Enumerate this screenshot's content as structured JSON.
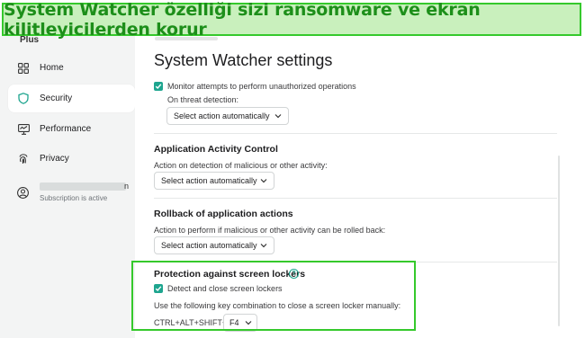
{
  "banner": {
    "text": "System Watcher özelliği sizi ransomware ve ekran kilitleyicilerden korur"
  },
  "sidebar": {
    "brand": "Plus",
    "items": [
      {
        "label": "Home",
        "icon": "grid-icon",
        "active": false
      },
      {
        "label": "Security",
        "icon": "shield-icon",
        "active": true
      },
      {
        "label": "Performance",
        "icon": "monitor-icon",
        "active": false
      },
      {
        "label": "Privacy",
        "icon": "fingerprint-icon",
        "active": false
      }
    ],
    "user": {
      "name_tail": "n",
      "subscription": "Subscription is active",
      "icon": "user-icon"
    }
  },
  "main": {
    "title": "System Watcher settings",
    "monitor": {
      "checkbox_label": "Monitor attempts to perform unauthorized operations",
      "checked": true,
      "sub_label": "On threat detection:",
      "select_value": "Select action automatically"
    },
    "aac": {
      "heading": "Application Activity Control",
      "sub_label": "Action on detection of malicious or other activity:",
      "select_value": "Select action automatically"
    },
    "rollback": {
      "heading": "Rollback of application actions",
      "sub_label": "Action to perform if malicious or other activity can be rolled back:",
      "select_value": "Select action automatically"
    },
    "lockers": {
      "heading": "Protection against screen lockers",
      "help_icon": "?",
      "checkbox_label": "Detect and close screen lockers",
      "checked": true,
      "sub_label": "Use the following key combination to close a screen locker manually:",
      "key_combo": "CTRL+ALT+SHIFT+",
      "key_value": "F4"
    }
  },
  "colors": {
    "accent": "#1ea58f",
    "highlight": "#35c92c",
    "banner_bg": "#c9f0bd",
    "banner_text": "#1d8f1a"
  }
}
